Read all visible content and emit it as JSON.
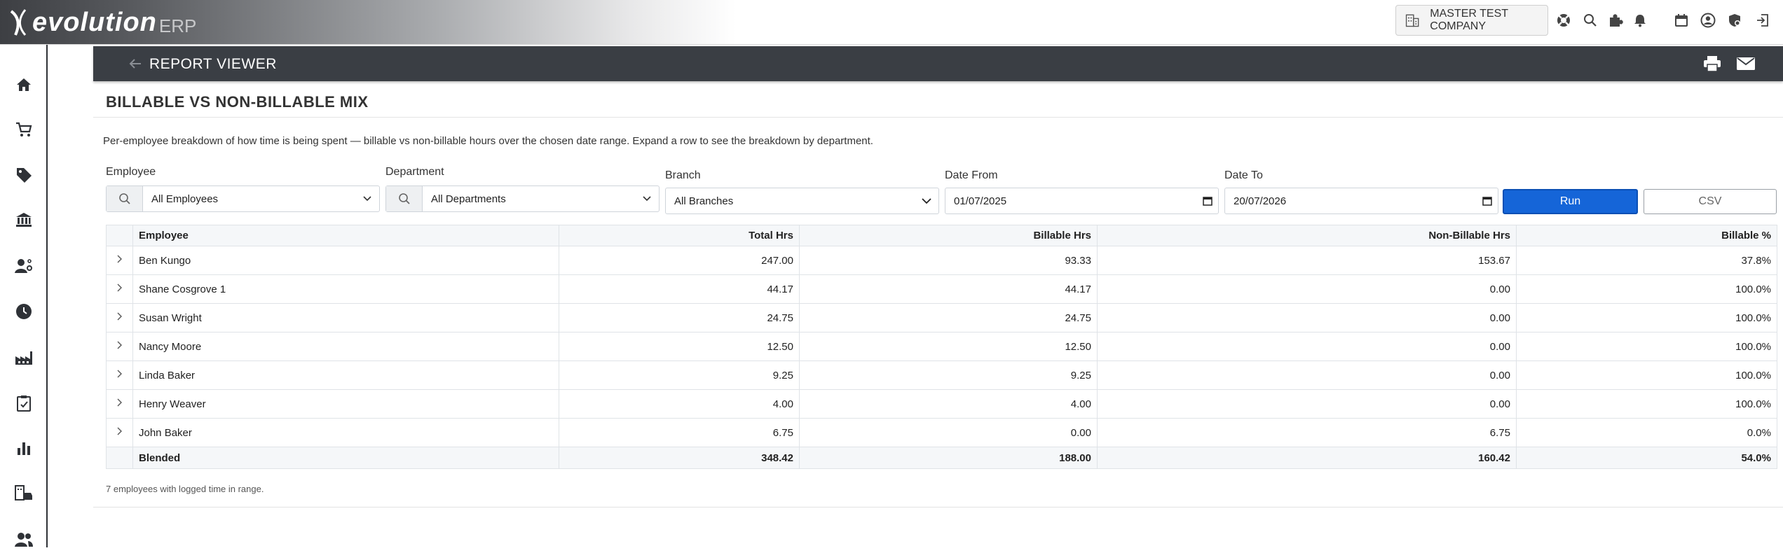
{
  "app": {
    "logo_text": "evolution",
    "logo_suffix": "ERP",
    "company": "MASTER TEST COMPANY"
  },
  "top_icons": [
    "lifebuoy-icon",
    "search-icon",
    "puzzle-icon",
    "bell-icon",
    "calendar-icon",
    "user-icon",
    "shield-icon",
    "logout-icon"
  ],
  "sidebar": {
    "items": [
      "home-icon",
      "cart-icon",
      "tag-icon",
      "bank-icon",
      "user-settings-icon",
      "clock-icon",
      "factory-icon",
      "clipboard-check-icon",
      "bar-chart-icon",
      "building-car-icon",
      "people-icon"
    ]
  },
  "header": {
    "title": "REPORT VIEWER"
  },
  "report": {
    "title": "BILLABLE VS NON-BILLABLE MIX",
    "description": "Per-employee breakdown of how time is being spent — billable vs non-billable hours over the chosen date range. Expand a row to see the breakdown by department."
  },
  "filters": {
    "employee_label": "Employee",
    "employee_value": "All Employees",
    "department_label": "Department",
    "department_value": "All Departments",
    "branch_label": "Branch",
    "branch_value": "All Branches",
    "date_from_label": "Date From",
    "date_from_value": "01/07/2025",
    "date_to_label": "Date To",
    "date_to_value": "20/07/2026",
    "run_label": "Run",
    "csv_label": "CSV"
  },
  "table": {
    "columns": [
      "Employee",
      "Total Hrs",
      "Billable Hrs",
      "Non-Billable Hrs",
      "Billable %"
    ],
    "rows": [
      [
        "Ben Kungo",
        "247.00",
        "93.33",
        "153.67",
        "37.8%"
      ],
      [
        "Shane Cosgrove 1",
        "44.17",
        "44.17",
        "0.00",
        "100.0%"
      ],
      [
        "Susan Wright",
        "24.75",
        "24.75",
        "0.00",
        "100.0%"
      ],
      [
        "Nancy Moore",
        "12.50",
        "12.50",
        "0.00",
        "100.0%"
      ],
      [
        "Linda Baker",
        "9.25",
        "9.25",
        "0.00",
        "100.0%"
      ],
      [
        "Henry Weaver",
        "4.00",
        "4.00",
        "0.00",
        "100.0%"
      ],
      [
        "John Baker",
        "6.75",
        "0.00",
        "6.75",
        "0.0%"
      ]
    ],
    "total": [
      "Blended",
      "348.42",
      "188.00",
      "160.42",
      "54.0%"
    ]
  },
  "footnote": "7 employees with logged time in range.",
  "colors": {
    "header_bg": "#3a3e44",
    "run_button": "#1565d8"
  }
}
